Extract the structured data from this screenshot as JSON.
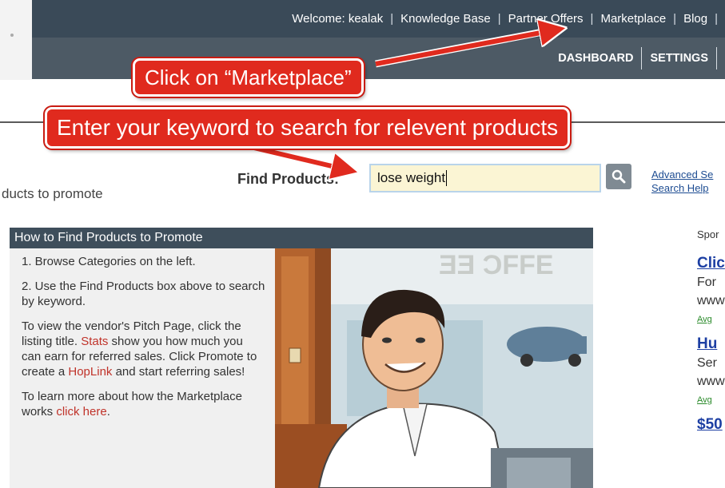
{
  "header": {
    "welcome": "Welcome: kealak",
    "links": [
      "Knowledge Base",
      "Partner Offers",
      "Marketplace",
      "Blog"
    ],
    "nav": [
      "DASHBOARD",
      "SETTINGS"
    ]
  },
  "callouts": {
    "marketplace": "Click on “Marketplace”",
    "keyword": "Enter your keyword to search for relevent products"
  },
  "search": {
    "intro": "ducts to promote",
    "label": "Find Products:",
    "value": "lose weight",
    "advanced": "Advanced Se",
    "help": "Search Help"
  },
  "panel": {
    "title": "How to Find Products to Promote",
    "step1": "1. Browse Categories on the left.",
    "step2": "2. Use the Find Products box above to search by keyword.",
    "para3_a": "To view the vendor's Pitch Page, click the listing title. ",
    "para3_stats": "Stats",
    "para3_b": " show you how much you can earn for referred sales. Click Promote to create a ",
    "para3_hoplink": "HopLink",
    "para3_c": " and start referring sales!",
    "para4_a": "To learn more about how the Marketplace works ",
    "para4_link": "click here",
    "para4_b": "."
  },
  "sponsored": {
    "label": "Spor",
    "ads": [
      {
        "title": "Clic",
        "line1": "For",
        "line2": "www",
        "meta": "Avg"
      },
      {
        "title": "Hu",
        "line1": "Ser",
        "line2": "www",
        "meta": "Avg"
      },
      {
        "title": "$50"
      }
    ]
  },
  "colors": {
    "topbar": "#3a4a58",
    "dashbar": "#4d5a65",
    "callout": "#e02a1e",
    "link": "#1d4c92",
    "search_bg": "#fbf5d4"
  }
}
